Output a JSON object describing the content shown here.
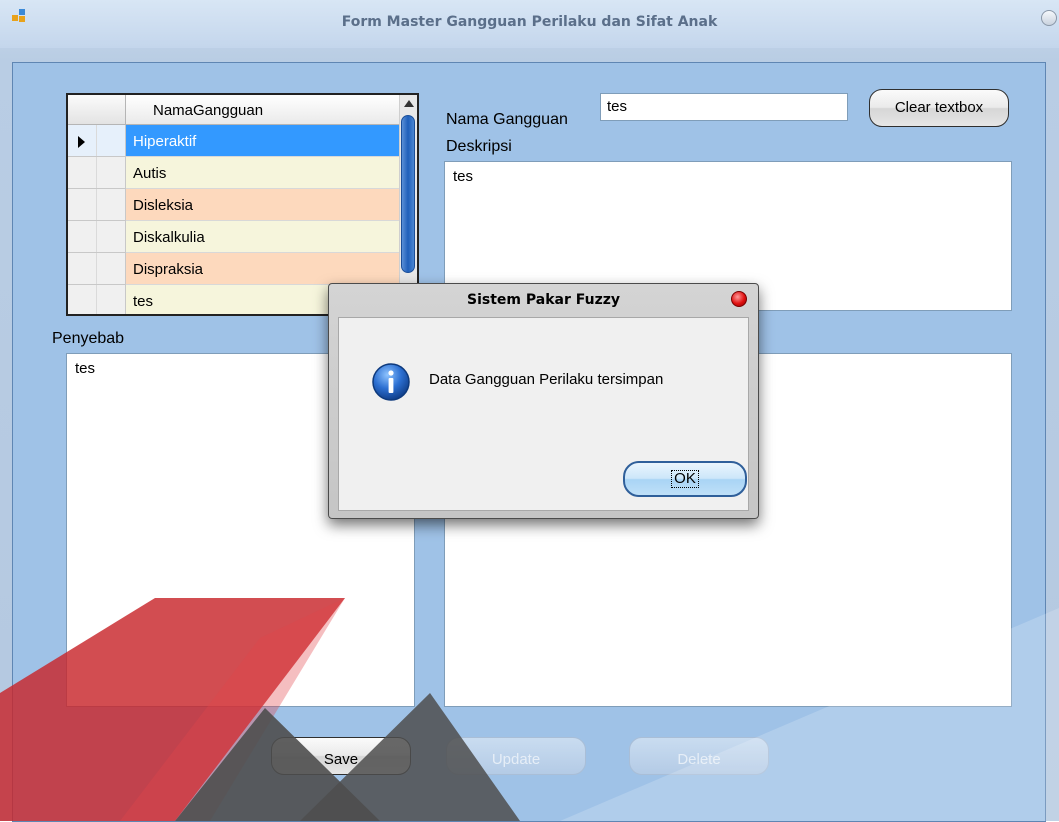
{
  "window": {
    "title": "Form Master Gangguan Perilaku dan Sifat Anak"
  },
  "grid": {
    "column_header": "NamaGangguan",
    "rows": [
      "Hiperaktif",
      "Autis",
      "Disleksia",
      "Diskalkulia",
      "Dispraksia",
      "tes"
    ],
    "selected_index": 0
  },
  "form": {
    "nama_label": "Nama Gangguan",
    "nama_value": "tes",
    "deskripsi_label": "Deskripsi",
    "deskripsi_value": "tes",
    "penyebab_label": "Penyebab",
    "penyebab_value": "tes",
    "clear_label": "Clear textbox"
  },
  "actions": {
    "save_label": "Save",
    "update_label": "Update",
    "delete_label": "Delete"
  },
  "dialog": {
    "title": "Sistem Pakar Fuzzy",
    "message": "Data Gangguan Perilaku tersimpan",
    "ok_label": "OK"
  },
  "colors": {
    "row_selected": "#3399ff",
    "row_even": "#f6f5dc",
    "row_odd": "#fdd9bd",
    "client_background": "#9fc2e7",
    "watermark_red": "#c8262b",
    "watermark_gray": "#4e4e4e"
  }
}
